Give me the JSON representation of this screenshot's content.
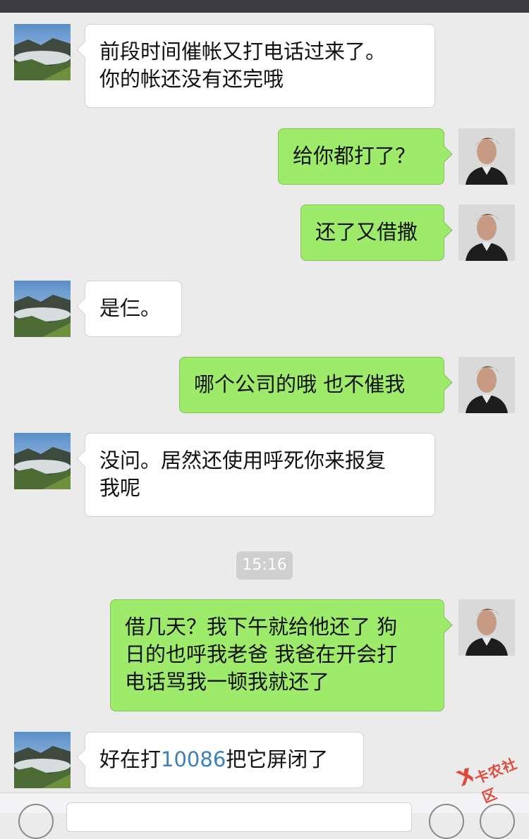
{
  "chat": {
    "messages": [
      {
        "from": "them",
        "text": "前段时间催帐又打电话过来了。\n你的帐还没有还完哦"
      },
      {
        "from": "me",
        "text": "给你都打了？"
      },
      {
        "from": "me",
        "text": "还了又借撒"
      },
      {
        "from": "them",
        "text": "是仨。"
      },
      {
        "from": "me",
        "text": "哪个公司的哦 也不催我"
      },
      {
        "from": "them",
        "text": "没问。居然还使用呼死你来报复\n我呢"
      },
      {
        "from": "me",
        "text": "借几天？我下午就给他还了 狗\n日的也呼我老爸 我爸在开会打\n电话骂我一顿我就还了"
      },
      {
        "from": "them",
        "text_before": "好在打",
        "link": "10086",
        "text_after": "把它屏闭了"
      }
    ],
    "timestamp": "15:16"
  },
  "watermark": {
    "text": "卡农社区"
  },
  "colors": {
    "background": "#ebebeb",
    "outgoing_bubble": "#9eea6a",
    "incoming_bubble": "#ffffff",
    "link": "#3b7fbf"
  },
  "icons": {
    "contact_avatar": "mountain-landscape-avatar",
    "my_avatar": "portrait-avatar",
    "voice_button": "voice-icon",
    "emoji_button": "emoji-icon",
    "plus_button": "plus-icon"
  }
}
